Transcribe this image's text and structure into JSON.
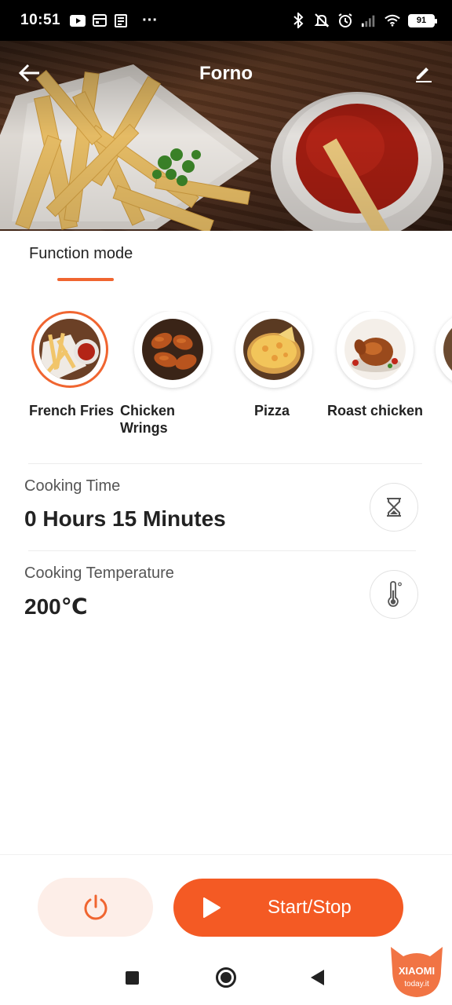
{
  "status_bar": {
    "time": "10:51",
    "more": "···",
    "battery": "91"
  },
  "header": {
    "title": "Forno"
  },
  "function_tab": {
    "label": "Function mode"
  },
  "modes": [
    {
      "label": "French Fries",
      "selected": true
    },
    {
      "label": "Chicken Wrings",
      "selected": false
    },
    {
      "label": "Pizza",
      "selected": false
    },
    {
      "label": "Roast chicken",
      "selected": false
    }
  ],
  "cooking_time": {
    "label": "Cooking Time",
    "value": "0 Hours 15 Minutes"
  },
  "cooking_temperature": {
    "label": "Cooking Temperature",
    "value": "200℃"
  },
  "controls": {
    "start_label": "Start/Stop"
  },
  "watermark": {
    "brand": "XIAOMI",
    "site": "today.it"
  },
  "colors": {
    "accent": "#f45a24",
    "power_bg": "#fdeee8"
  }
}
